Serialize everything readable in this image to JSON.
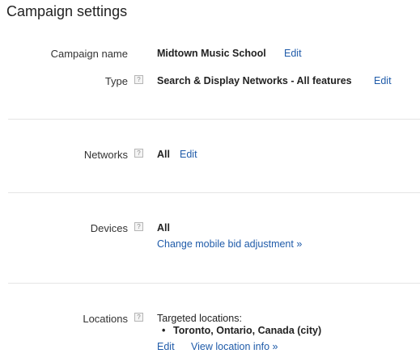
{
  "page_title": "Campaign settings",
  "fields": {
    "campaign_name": {
      "label": "Campaign name",
      "value": "Midtown Music School",
      "edit": "Edit"
    },
    "type": {
      "label": "Type",
      "value": "Search & Display Networks - All features",
      "edit": "Edit"
    },
    "networks": {
      "label": "Networks",
      "value": "All",
      "edit": "Edit"
    },
    "devices": {
      "label": "Devices",
      "value": "All",
      "link": "Change mobile bid adjustment »"
    },
    "locations": {
      "label": "Locations",
      "heading": "Targeted locations:",
      "items": [
        "Toronto, Ontario, Canada (city)"
      ],
      "edit": "Edit",
      "view_info": "View location info »"
    }
  },
  "help_glyph": "?",
  "bullet_glyph": "•"
}
